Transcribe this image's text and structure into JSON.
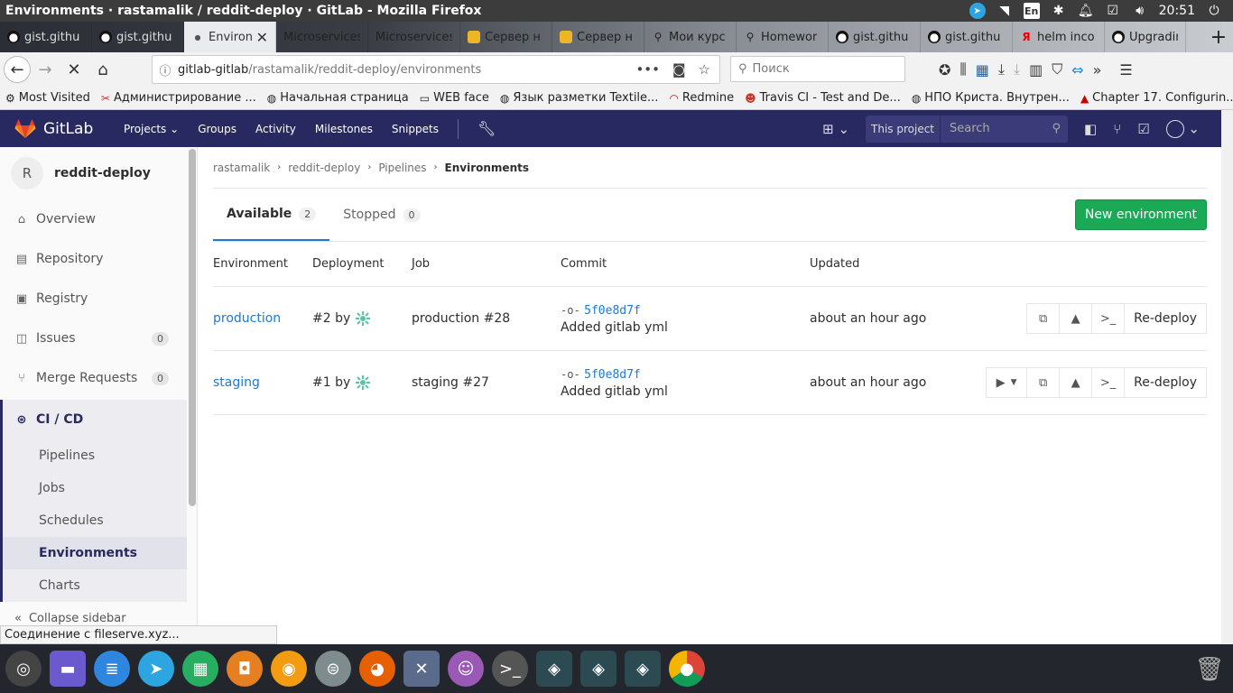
{
  "os": {
    "window_title": "Environments · rastamalik / reddit-deploy · GitLab - Mozilla Firefox",
    "keyboard_layout": "En",
    "clock": "20:51"
  },
  "browser": {
    "tabs": [
      {
        "label": "gist.githu",
        "icon": "github-icon"
      },
      {
        "label": "gist.githu",
        "icon": "github-icon"
      },
      {
        "label": "Environ",
        "icon": "dot-icon",
        "active": true
      },
      {
        "label": "Microservices",
        "icon": "none"
      },
      {
        "label": "Microservices",
        "icon": "none"
      },
      {
        "label": "Сервер н",
        "icon": "chat-icon"
      },
      {
        "label": "Сервер н",
        "icon": "chat-icon"
      },
      {
        "label": "Мои курс",
        "icon": "course-icon"
      },
      {
        "label": "Homewor",
        "icon": "course-icon"
      },
      {
        "label": "gist.githu",
        "icon": "github-icon"
      },
      {
        "label": "gist.githu",
        "icon": "github-icon"
      },
      {
        "label": "helm inco",
        "icon": "yandex-icon"
      },
      {
        "label": "Upgradin",
        "icon": "github-icon"
      }
    ],
    "url_host": "gitlab-gitlab",
    "url_path": "/rastamalik/reddit-deploy/environments",
    "search_placeholder": "Поиск",
    "bookmarks": [
      {
        "label": "Most Visited",
        "icon": "gear-icon"
      },
      {
        "label": "Администрирование ...",
        "icon": "tools-icon"
      },
      {
        "label": "Начальная страница",
        "icon": "globe-icon"
      },
      {
        "label": "WEB face",
        "icon": "folder-icon"
      },
      {
        "label": "Язык разметки Textile...",
        "icon": "globe-icon"
      },
      {
        "label": "Redmine",
        "icon": "redmine-icon"
      },
      {
        "label": "Travis CI - Test and De...",
        "icon": "travis-icon"
      },
      {
        "label": "НПО Криста. Внутрен...",
        "icon": "globe-icon"
      },
      {
        "label": "Chapter 17. Configurin...",
        "icon": "redhat-icon"
      }
    ],
    "status_text": "Соединение с fileserve.xyz..."
  },
  "gitlab": {
    "brand": "GitLab",
    "nav": [
      "Projects",
      "Groups",
      "Activity",
      "Milestones",
      "Snippets"
    ],
    "this_project": "This project",
    "search_placeholder": "Search",
    "accent": "#292961",
    "sidebar": {
      "avatar_letter": "R",
      "project_name": "reddit-deploy",
      "items": [
        {
          "label": "Overview",
          "icon": "home-icon"
        },
        {
          "label": "Repository",
          "icon": "book-icon"
        },
        {
          "label": "Registry",
          "icon": "registry-icon"
        },
        {
          "label": "Issues",
          "icon": "issues-icon",
          "count": "0"
        },
        {
          "label": "Merge Requests",
          "icon": "merge-request-icon",
          "count": "0"
        },
        {
          "label": "CI / CD",
          "icon": "rocket-icon"
        }
      ],
      "cicd_sub": [
        "Pipelines",
        "Jobs",
        "Schedules",
        "Environments",
        "Charts"
      ],
      "collapse_label": "Collapse sidebar"
    },
    "breadcrumbs": [
      "rastamalik",
      "reddit-deploy",
      "Pipelines",
      "Environments"
    ],
    "env_tabs": [
      {
        "label": "Available",
        "count": "2"
      },
      {
        "label": "Stopped",
        "count": "0"
      }
    ],
    "new_env_button": "New environment",
    "table_headers": [
      "Environment",
      "Deployment",
      "Job",
      "Commit",
      "Updated"
    ],
    "rows": [
      {
        "environment": "production",
        "deployment": "#2 by",
        "job": "production #28",
        "sha": "5f0e8d7f",
        "message": "Added gitlab yml",
        "updated": "about an hour ago",
        "redeploy": "Re-deploy"
      },
      {
        "environment": "staging",
        "deployment": "#1 by",
        "job": "staging #27",
        "sha": "5f0e8d7f",
        "message": "Added gitlab yml",
        "updated": "about an hour ago",
        "redeploy": "Re-deploy"
      }
    ]
  },
  "dock_apps": [
    "ubuntu-icon",
    "files-icon",
    "notes-icon",
    "telegram-icon",
    "spreadsheet-icon",
    "image-viewer-icon",
    "screenshot-icon",
    "settings-toggle-icon",
    "firefox-icon",
    "xwindow-icon",
    "pidgin-icon",
    "terminal-icon",
    "remote-icon",
    "remote-icon",
    "remote-icon",
    "chrome-icon"
  ]
}
